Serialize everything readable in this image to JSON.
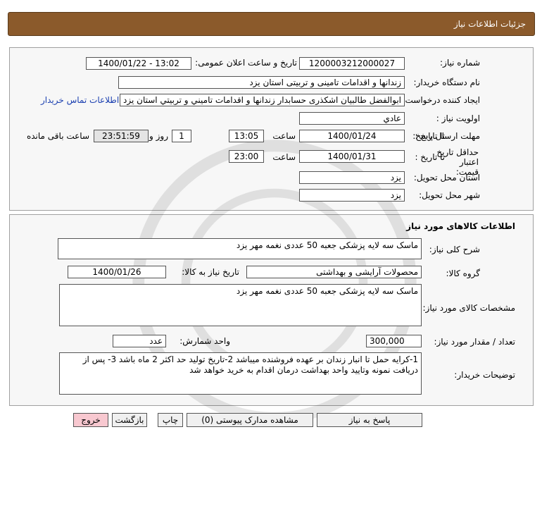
{
  "header": {
    "title": "جزئیات اطلاعات نیاز"
  },
  "info": {
    "need_number_label": "شماره نیاز:",
    "need_number": "1200003212000027",
    "announce_label": "تاریخ و ساعت اعلان عمومی:",
    "announce_value": "1400/01/22 - 13:02",
    "buyer_org_label": "نام دستگاه خریدار:",
    "buyer_org": "زندانها و اقدامات تامینی و تربیتی استان یزد",
    "creator_label": "ایجاد کننده درخواست:",
    "creator": "ابوالفضل  طالبیان اشکذری حسابدار زندانها و اقدامات تامیني و تربيتي استان یزد",
    "contact_link": "اطلاعات تماس خریدار",
    "priority_label": "اولویت نیاز :",
    "priority": "عادي",
    "deadline_label": "مهلت ارسال پاسخ:",
    "to_date_label": "تا تاریخ :",
    "deadline_date": "1400/01/24",
    "time_label": "ساعت",
    "deadline_time": "13:05",
    "days_value": "1",
    "days_label": "روز و",
    "remaining_time": "23:51:59",
    "remaining_label": "ساعت باقی مانده",
    "price_validity_label": "حداقل تاریخ اعتبار قیمت:",
    "validity_to_label": "تا تاریخ :",
    "validity_date": "1400/01/31",
    "validity_time_label": "ساعت",
    "validity_time": "23:00",
    "province_label": "استان محل تحویل:",
    "province": "یزد",
    "city_label": "شهر محل تحویل:",
    "city": "یزد"
  },
  "goods": {
    "section_title": "اطلاعات کالاهای مورد نیاز",
    "general_desc_label": "شرح کلی نیاز:",
    "general_desc": "ماسک سه لایه پزشکی جعبه 50 عددی نغمه مهر یزد",
    "group_label": "گروه کالا:",
    "group": "محصولات آرایشی و بهداشتی",
    "need_date_label": "تاریخ نیاز به کالا:",
    "need_date": "1400/01/26",
    "specs_label": "مشخصات کالای مورد نیاز:",
    "specs": "ماسک سه لایه پزشکی جعبه 50 عددی نغمه مهر یزد",
    "qty_label": "تعداد / مقدار مورد نیاز:",
    "qty": "300,000",
    "unit_label": "واحد شمارش:",
    "unit": "عدد",
    "buyer_notes_label": "توضیحات خریدار:",
    "buyer_notes": "1-کرایه حمل تا انبار زندان بر عهده فروشنده میباشد 2-تاریخ تولید حد اکثر 2 ماه باشد 3- پس از دریافت نمونه وتایید واحد بهداشت درمان اقدام به خرید خواهد شد"
  },
  "buttons": {
    "reply": "پاسخ به نیاز",
    "attachments": "مشاهده مدارک پیوستی (0)",
    "print": "چاپ",
    "back": "بازگشت",
    "exit": "خروج"
  }
}
